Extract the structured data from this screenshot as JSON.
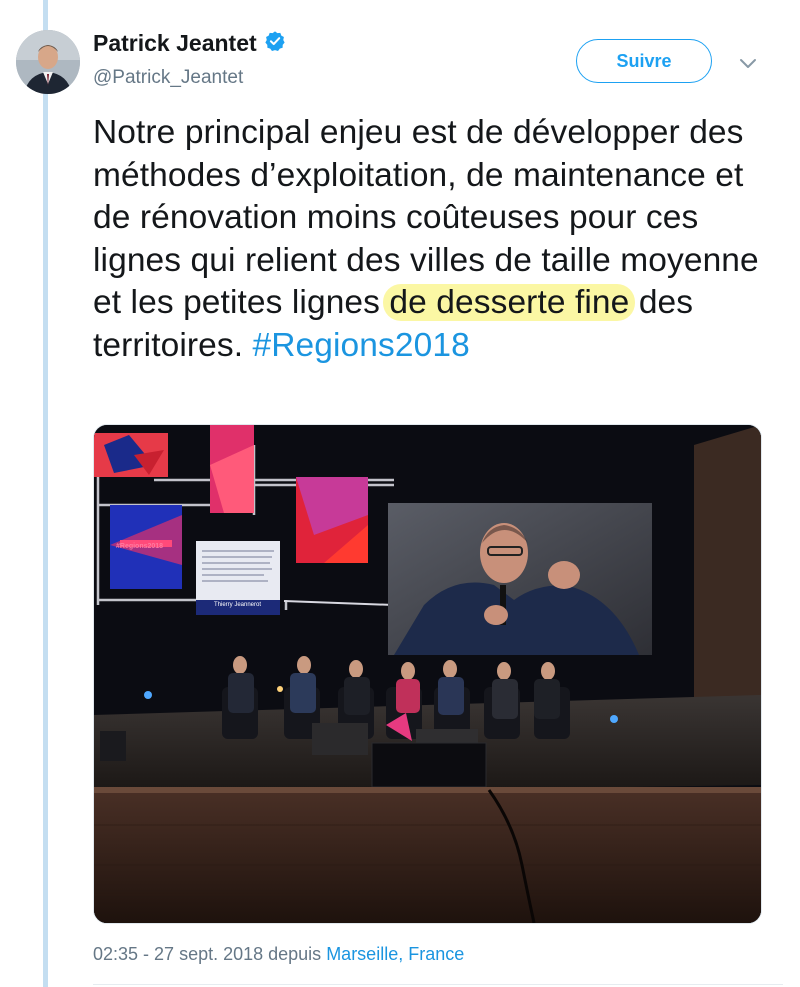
{
  "tweet": {
    "author": {
      "name": "Patrick Jeantet",
      "handle": "@Patrick_Jeantet",
      "verified": true
    },
    "follow_label": "Suivre",
    "text_parts": {
      "before_highlight": "Notre principal enjeu est de développer des méthodes d’exploitation, de maintenance et de rénovation moins coûteuses pour ces lignes qui relient des villes de taille moyenne et les petites lignes ",
      "highlight": "de desserte fine",
      "after_highlight": " des territoires. ",
      "hashtag": "#Regions2018"
    },
    "photo": {
      "banner_text": "#Regions2018",
      "screen_caption_name": "Thierry Jeannerot"
    },
    "meta": {
      "time_date": "02:35 - 27 sept. 2018 depuis ",
      "location": "Marseille, France"
    }
  },
  "colors": {
    "link": "#1b95e0",
    "follow_border": "#1da1f2",
    "highlight": "#fbf7a4",
    "thread_line": "#c4def1",
    "verified": "#1da1f2"
  },
  "icons": [
    "verified-badge-icon",
    "chevron-down-icon"
  ]
}
